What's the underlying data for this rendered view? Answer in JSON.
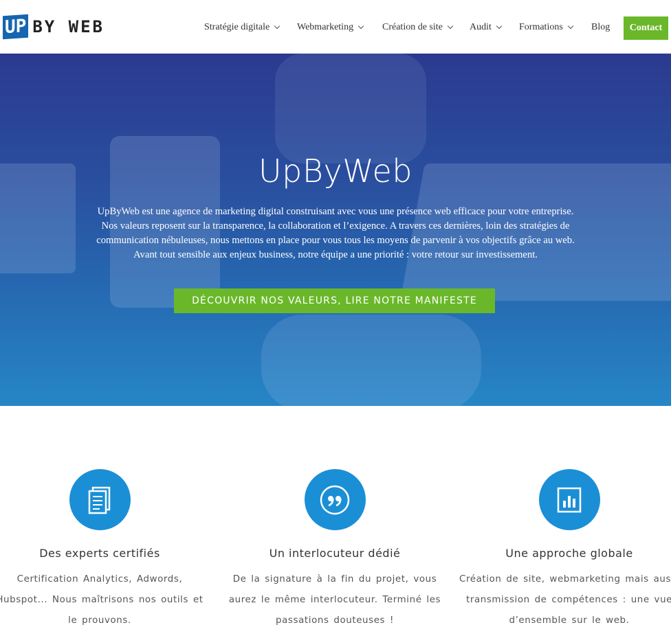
{
  "logo": {
    "box_text": "UP",
    "text": "BY WEB"
  },
  "nav": {
    "items": [
      {
        "label": "Stratégie digitale",
        "has_dropdown": true
      },
      {
        "label": "Webmarketing",
        "has_dropdown": true
      },
      {
        "label": "Création de site",
        "has_dropdown": true
      },
      {
        "label": "Audit",
        "has_dropdown": true
      },
      {
        "label": "Formations",
        "has_dropdown": true
      },
      {
        "label": "Blog",
        "has_dropdown": false
      }
    ],
    "contact_label": "Contact"
  },
  "hero": {
    "title": "UpByWeb",
    "text": "UpByWeb est une agence de marketing digital construisant avec vous une présence web efficace pour votre entreprise. Nos valeurs reposent sur la transparence, la collaboration et l’exigence. A travers ces dernières, loin des stratégies de communication nébuleuses, nous mettons en place pour vous tous les moyens de parvenir à vos objectifs grâce au web. Avant tout sensible aux enjeux business, notre équipe a une priorité : votre retour sur investissement.",
    "button_label": "DÉCOUVRIR NOS VALEURS, LIRE NOTRE MANIFESTE"
  },
  "features": [
    {
      "icon": "document-icon",
      "title": "Des experts certifiés",
      "text": "Certification Analytics, Adwords, Hubspot... Nous maîtrisons nos outils et le prouvons."
    },
    {
      "icon": "quote-icon",
      "title": "Un interlocuteur dédié",
      "text": "De la signature à la fin du projet, vous aurez le même interlocuteur. Terminé les passations douteuses !"
    },
    {
      "icon": "bar-chart-icon",
      "title": "Une approche globale",
      "text": "Création de site, webmarketing mais aussi transmission de compétences : une vue d’ensemble sur le web."
    }
  ],
  "colors": {
    "accent_green": "#6ab82a",
    "icon_blue": "#1a8fd6",
    "hero_top": "#2b3a8f",
    "hero_bottom": "#2686c6"
  }
}
